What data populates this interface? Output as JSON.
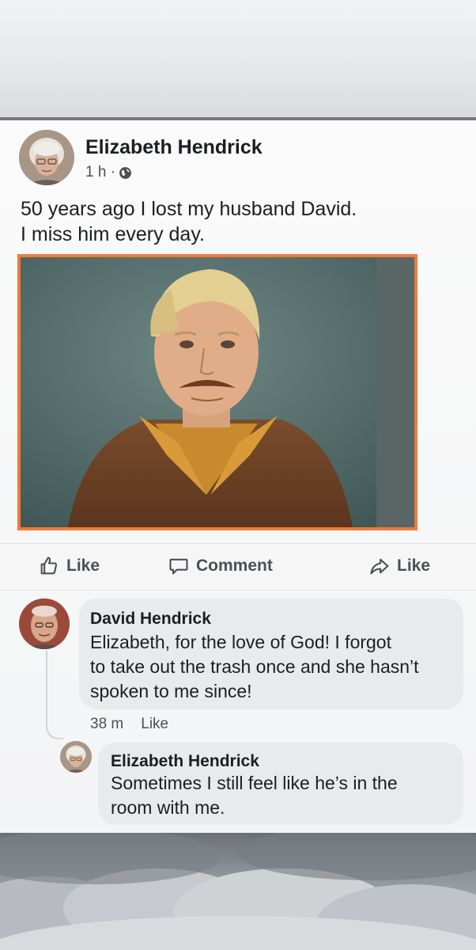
{
  "post": {
    "author": "Elizabeth Hendrick",
    "time": "1 h ·",
    "text_lines": [
      "50 years ago I lost my husband David.",
      "I miss him every day."
    ]
  },
  "icons": {
    "post_avatar": "elderly-woman-avatar-icon",
    "privacy": "globe-icon",
    "like": "thumbs-up-icon",
    "comment": "speech-bubble-icon",
    "share": "share-arrow-icon",
    "comment_avatar": "elderly-man-avatar-icon"
  },
  "actions": {
    "like_label": "Like",
    "comment_label": "Comment",
    "share_label": "Like"
  },
  "comments": [
    {
      "author": "David Hendrick",
      "text_lines": [
        "Elizabeth, for the love of God! I forgot",
        "to take out the trash once and she hasn’t",
        "spoken to me since!"
      ],
      "time": "38 m",
      "like_label": "Like"
    },
    {
      "author": "Elizabeth Hendrick",
      "text_lines": [
        "Sometimes I still feel like he’s in the",
        "room with me."
      ]
    }
  ],
  "colors": {
    "photo_border": "#ec7a3c",
    "text": "#1c1e21",
    "secondary_text": "#4b4f56",
    "bubble": "#e9eaec"
  }
}
